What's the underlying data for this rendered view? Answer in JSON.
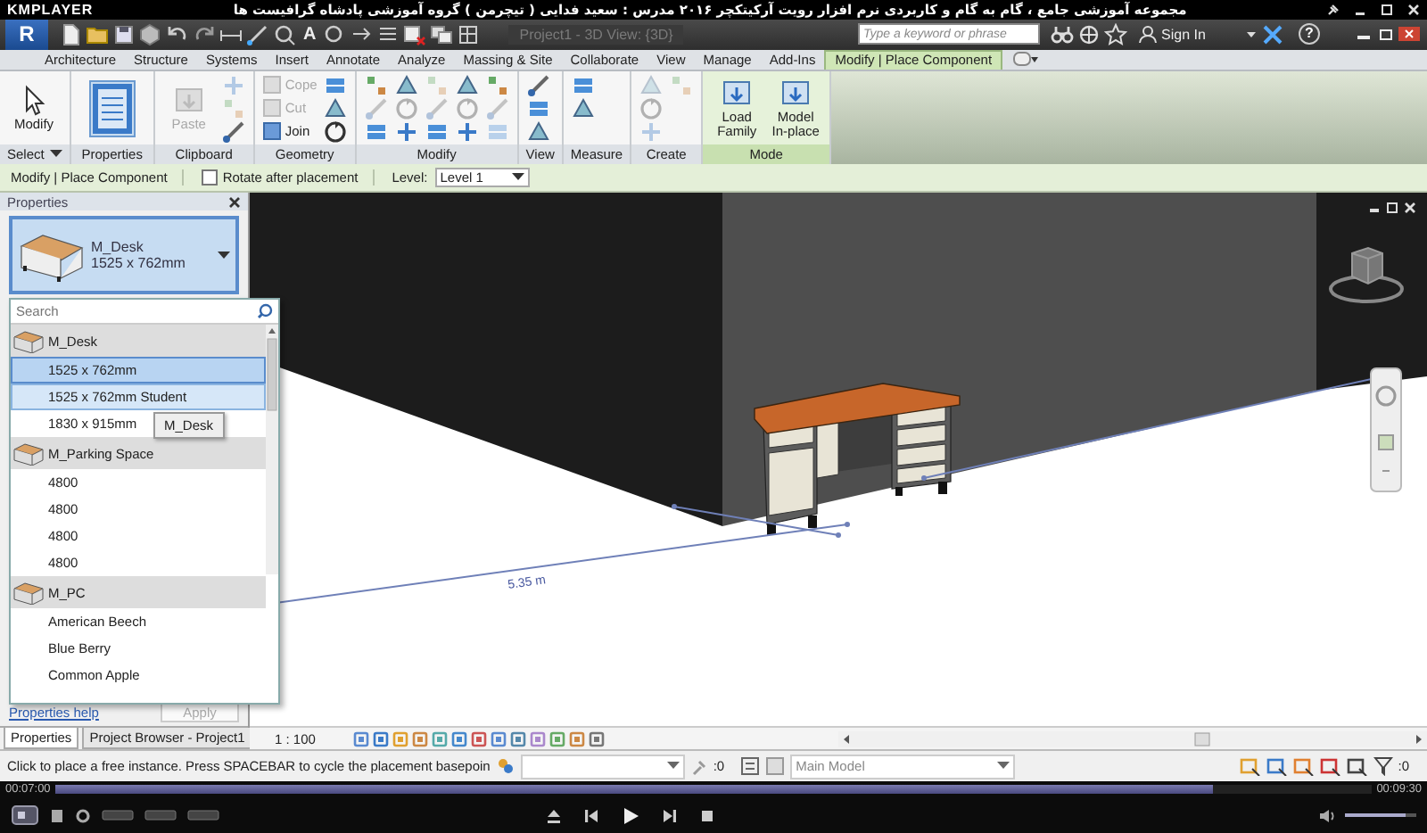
{
  "player": {
    "logo": "KMPLAYER",
    "title": "مجموعه آموزشی جامع ، گام به گام و کاربردی نرم افزار رویت آرکیتکچر ۲۰۱۶   مدرس : سعید فدایی ( تیچرمن ) گروه آموزشی پادشاه گرافیست ها",
    "time_elapsed": "00:07:00",
    "time_total": "00:09:30",
    "seek": {
      "level": 0.88
    },
    "volume": {
      "level": 0.85
    }
  },
  "revit": {
    "app_letter": "R",
    "text_tool": "A",
    "window_title": "Project1 - 3D View: {3D}",
    "search": {
      "placeholder": "Type a keyword or phrase"
    },
    "sign_in": "Sign In",
    "help": "?",
    "tabs": [
      {
        "label": "Architecture",
        "selected": false
      },
      {
        "label": "Structure",
        "selected": false
      },
      {
        "label": "Systems",
        "selected": false
      },
      {
        "label": "Insert",
        "selected": false
      },
      {
        "label": "Annotate",
        "selected": false
      },
      {
        "label": "Analyze",
        "selected": false
      },
      {
        "label": "Massing & Site",
        "selected": false
      },
      {
        "label": "Collaborate",
        "selected": false
      },
      {
        "label": "View",
        "selected": false
      },
      {
        "label": "Manage",
        "selected": false
      },
      {
        "label": "Add-Ins",
        "selected": false
      },
      {
        "label": "Modify | Place Component",
        "selected": true
      }
    ],
    "ribbon_panels": [
      {
        "label": "Select",
        "dropdown": true,
        "contextual": false,
        "items": [
          {
            "kind": "large",
            "label": "Modify",
            "disabled": false
          }
        ]
      },
      {
        "label": "Properties",
        "dropdown": false,
        "contextual": false,
        "items": [
          {
            "kind": "large-icon",
            "disabled": false
          }
        ]
      },
      {
        "label": "Clipboard",
        "dropdown": false,
        "contextual": false,
        "items": [
          {
            "kind": "large",
            "label": "Paste",
            "disabled": true
          },
          {
            "kind": "icon",
            "disabled": true
          },
          {
            "kind": "icon",
            "disabled": true
          },
          {
            "kind": "icon",
            "disabled": false
          }
        ]
      },
      {
        "label": "Geometry",
        "dropdown": false,
        "contextual": false,
        "items": [
          {
            "kind": "small",
            "label": "Cope",
            "disabled": true
          },
          {
            "kind": "small",
            "label": "Cut",
            "disabled": true
          },
          {
            "kind": "small",
            "label": "Join",
            "disabled": false
          },
          {
            "kind": "icon",
            "disabled": false
          },
          {
            "kind": "icon",
            "disabled": false
          },
          {
            "kind": "icon",
            "disabled": false
          }
        ]
      },
      {
        "label": "Modify",
        "dropdown": false,
        "contextual": false,
        "items": [
          {
            "kind": "icon",
            "disabled": false
          },
          {
            "kind": "icon",
            "disabled": true
          },
          {
            "kind": "icon",
            "disabled": false
          },
          {
            "kind": "icon",
            "disabled": false
          },
          {
            "kind": "icon",
            "disabled": true
          },
          {
            "kind": "icon",
            "disabled": false
          },
          {
            "kind": "icon",
            "disabled": true
          },
          {
            "kind": "icon",
            "disabled": true
          },
          {
            "kind": "icon",
            "disabled": false
          },
          {
            "kind": "icon",
            "disabled": false
          },
          {
            "kind": "icon",
            "disabled": true
          },
          {
            "kind": "icon",
            "disabled": false
          },
          {
            "kind": "icon",
            "disabled": false
          },
          {
            "kind": "icon",
            "disabled": true
          },
          {
            "kind": "icon",
            "disabled": true
          }
        ]
      },
      {
        "label": "View",
        "dropdown": false,
        "contextual": false,
        "items": [
          {
            "kind": "icon",
            "disabled": false
          },
          {
            "kind": "icon",
            "disabled": false
          },
          {
            "kind": "icon",
            "disabled": false
          }
        ]
      },
      {
        "label": "Measure",
        "dropdown": false,
        "contextual": false,
        "items": [
          {
            "kind": "icon",
            "disabled": false
          },
          {
            "kind": "icon",
            "disabled": false
          }
        ]
      },
      {
        "label": "Create",
        "dropdown": false,
        "contextual": false,
        "items": [
          {
            "kind": "icon",
            "disabled": true
          },
          {
            "kind": "icon",
            "disabled": true
          },
          {
            "kind": "icon",
            "disabled": true
          },
          {
            "kind": "icon",
            "disabled": true
          }
        ]
      },
      {
        "label": "Mode",
        "dropdown": false,
        "contextual": true,
        "items": [
          {
            "kind": "large",
            "label": "Load Family",
            "disabled": false
          },
          {
            "kind": "large",
            "label": "Model In-place",
            "disabled": false
          }
        ]
      }
    ],
    "options_bar": {
      "context": "Modify | Place Component",
      "rotate": {
        "label": "Rotate after placement",
        "checked": false
      },
      "level_label": "Level:",
      "level_value": "Level 1"
    },
    "properties": {
      "title": "Properties",
      "type_name": "M_Desk",
      "type_size": "1525 x 762mm",
      "search_placeholder": "Search",
      "tooltip": "M_Desk",
      "list": [
        {
          "kind": "family",
          "label": "M_Desk"
        },
        {
          "kind": "type",
          "label": "1525 x 762mm",
          "selected": true,
          "hovered": false
        },
        {
          "kind": "type",
          "label": "1525 x 762mm Student",
          "selected": false,
          "hovered": true
        },
        {
          "kind": "type",
          "label": "1830 x 915mm",
          "selected": false,
          "hovered": false
        },
        {
          "kind": "family",
          "label": "M_Parking Space"
        },
        {
          "kind": "type",
          "label": "4800",
          "selected": false,
          "hovered": false
        },
        {
          "kind": "type",
          "label": "4800",
          "selected": false,
          "hovered": false
        },
        {
          "kind": "type",
          "label": "4800",
          "selected": false,
          "hovered": false
        },
        {
          "kind": "type",
          "label": "4800",
          "selected": false,
          "hovered": false
        },
        {
          "kind": "family",
          "label": "M_PC"
        },
        {
          "kind": "type",
          "label": "American Beech",
          "selected": false,
          "hovered": false
        },
        {
          "kind": "type",
          "label": "Blue Berry",
          "selected": false,
          "hovered": false
        },
        {
          "kind": "type",
          "label": "Common Apple",
          "selected": false,
          "hovered": false
        }
      ],
      "help": "Properties help",
      "apply": {
        "label": "Apply",
        "disabled": true
      },
      "tabs": [
        {
          "label": "Properties",
          "selected": true
        },
        {
          "label": "Project Browser - Project1",
          "selected": false
        }
      ]
    },
    "viewport": {
      "dimension": "5.35 m",
      "scale": "1 : 100"
    },
    "status": {
      "message": "Click to place a free instance. Press SPACEBAR to cycle the placement basepoin",
      "selection_count": ":0",
      "model": "Main Model",
      "filter_count": ":0"
    }
  }
}
